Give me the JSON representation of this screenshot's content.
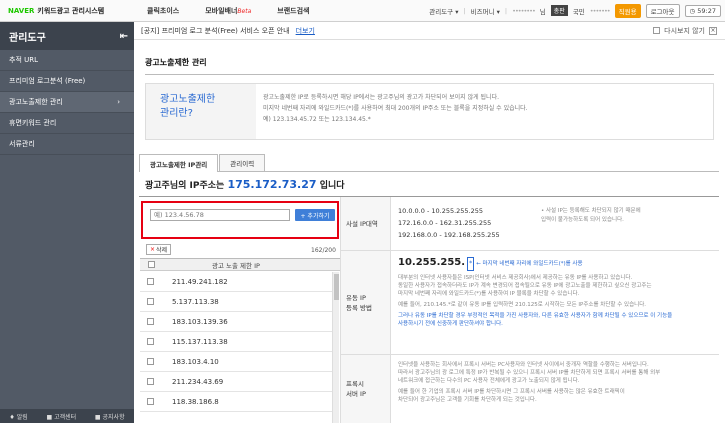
{
  "topbar": {
    "brand_naver": "NAVER",
    "brand_rest": "키워드광고 관리시스템",
    "nav": [
      {
        "label": "클릭초이스"
      },
      {
        "label": "모바일배너",
        "tag": "Beta"
      },
      {
        "label": "브랜드검색"
      }
    ],
    "menu_label": "관리도구 ▾",
    "biz_label": "비즈머니 ▾",
    "account_blur": "••••••••",
    "account_suffix": "님",
    "grade_badge": "총판",
    "national": "국민",
    "right_blur": "•••••••",
    "login_btn": "직원용",
    "logout_btn": "로그아웃",
    "clock": "59:27"
  },
  "sidebar": {
    "title": "관리도구",
    "items": [
      {
        "label": "추적 URL"
      },
      {
        "label": "프리미엄 로그분석 (Free)"
      },
      {
        "label": "광고노출제한 관리",
        "active": true
      },
      {
        "label": "휴면키워드 관리"
      },
      {
        "label": "서류관리"
      }
    ],
    "footer": [
      "알림",
      "고객센터",
      "공지사항"
    ]
  },
  "notice": {
    "text": "[공지] 프리미엄 로그 분석(Free) 서비스 오픈 안내",
    "link": "더보기",
    "hide_label": "다시보지 않기"
  },
  "page": {
    "title": "광고노출제한 관리",
    "info_title_line1": "광고노출제한",
    "info_title_line2": "관리란?",
    "info_lines": [
      "광고노출제한 IP로 등록하시면 해당 IP에서는 광고주님의 광고가 차단되어 보이지 않게 됩니다.",
      "미지막 네번째 자리에 와일드카드(*)를 사용하여 최대 200개의 IP주소 또는 블록을 지정하실 수 있습니다.",
      "예) 123.134.45.72 또는 123.134.45.*"
    ],
    "tabs": [
      "광고노출제한 IP관리",
      "관리이력"
    ],
    "ip_prefix": "광고주님의 IP주소는",
    "ip_value": "175.172.73.27",
    "ip_suffix": "입니다"
  },
  "ip_form": {
    "placeholder": "예) 123.4.56.78",
    "add_label": "+ 추가하기",
    "delete_label": "삭제",
    "count": "162/200",
    "column": "광고 노출 제한 IP",
    "rows": [
      "211.49.241.182",
      "5.137.113.38",
      "183.103.139.36",
      "115.137.113.38",
      "183.103.4.10",
      "211.234.43.69",
      "118.38.186.8"
    ]
  },
  "guide": {
    "private_label": "사설 IP대역",
    "private_ranges": [
      "10.0.0.0 - 10.255.255.255",
      "172.16.0.0 - 162.31.255.255",
      "192.168.0.0 - 192.168.255.255"
    ],
    "private_note": [
      "• 사설 IP는 등록해도 차단되지 않기 때문에",
      "입력이 불가능하도록 되어 있습니다."
    ],
    "dynamic_label_1": "유동 IP",
    "dynamic_label_2": "등록 방법",
    "dynamic_ip": "10.255.255.",
    "dynamic_star": "*",
    "dynamic_hint": "← 마지막 네번째 자리에 와일드카드(*)를 사용",
    "dynamic_lines": [
      "대부분의 인터넷 사용자들은 ISP(인터넷 서비스 제공회사)에서 제공하는 유동 IP를 사용하고 있습니다.",
      "동일한 사용자가 접속하더라도 IP가 계속 변경되어 접속될으로 유동 IP에 광고노출을 제한하고 싶으신 광고주는",
      "마지막 네번째 자리에 와일드카드(*)를 사용하여 IP 블록을 차단할 수 있습니다.",
      "예를 들어, 210.145.*로 같이 유동 IP를 입력하면 210.125로 시작하는 모든 IP주소를 차단할 수 있습니다."
    ],
    "dynamic_warn": [
      "그러나 유동 IP를 차단할 경우 부정적인 목적을 가진 사용자와, 다른 유효한 사용자가 함께 차단될 수 있으므로 이 기능을",
      "사용하시기 전에 신중하게 판단하셔야 합니다."
    ],
    "proxy_label_1": "프록시",
    "proxy_label_2": "서버 IP",
    "proxy_lines": [
      "인터넷을 사용하는 회사에서 프록시 서버는 PC사용자와 인터넷 사이에서 중개자 역할을 수행하는 서버입니다.",
      "따라서 광고주님의 광 로그에 특정 IP가 반복될 수 있으니 프록시 서버 IP를 차단하게 되면 프록시 서버를 통해 외부",
      "네트워크에 접근하는 다수의 PC 사용자 전체에게 광고가 노출되지 않게 됩니다.",
      "예를 들어 한 기업의 프록시 서버 IP를 차단하시면 그 프록시 서버를 사용하는 많은 유효한 트래픽이",
      "차단되어 광고주님은 고객을 기회를 차단하게 되는 것입니다."
    ]
  }
}
